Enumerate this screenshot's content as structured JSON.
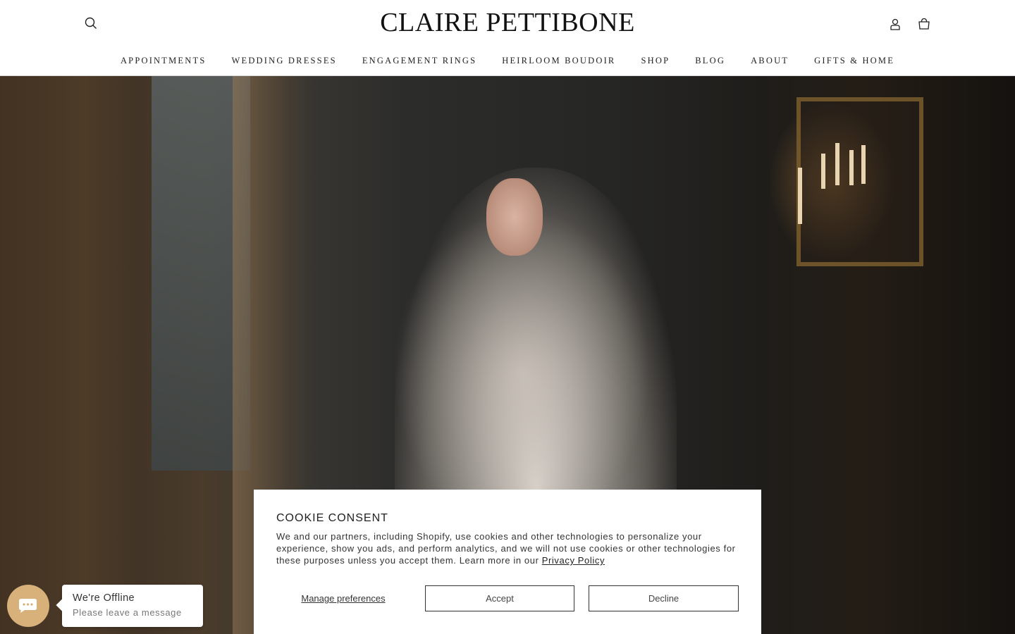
{
  "header": {
    "brand": "CLAIRE PETTIBONE",
    "search_icon": "search-icon",
    "account_icon": "user-icon",
    "cart_icon": "shopping-bag-icon"
  },
  "nav": {
    "items": [
      {
        "label": "APPOINTMENTS"
      },
      {
        "label": "WEDDING DRESSES"
      },
      {
        "label": "ENGAGEMENT RINGS"
      },
      {
        "label": "HEIRLOOM BOUDOIR"
      },
      {
        "label": "SHOP"
      },
      {
        "label": "BLOG"
      },
      {
        "label": "ABOUT"
      },
      {
        "label": "GIFTS & HOME"
      }
    ]
  },
  "cookie": {
    "title": "COOKIE CONSENT",
    "body": "We and our partners, including Shopify, use cookies and other technologies to personalize your experience, show you ads, and perform analytics, and we will not use cookies or other technologies for these purposes unless you accept them. Learn more in our ",
    "privacy_link": "Privacy Policy",
    "manage_label": "Manage preferences",
    "accept_label": "Accept",
    "decline_label": "Decline"
  },
  "chat": {
    "icon": "chat-icon",
    "title": "We're Offline",
    "subtitle": "Please leave a message",
    "accent": "#d7b07a"
  }
}
